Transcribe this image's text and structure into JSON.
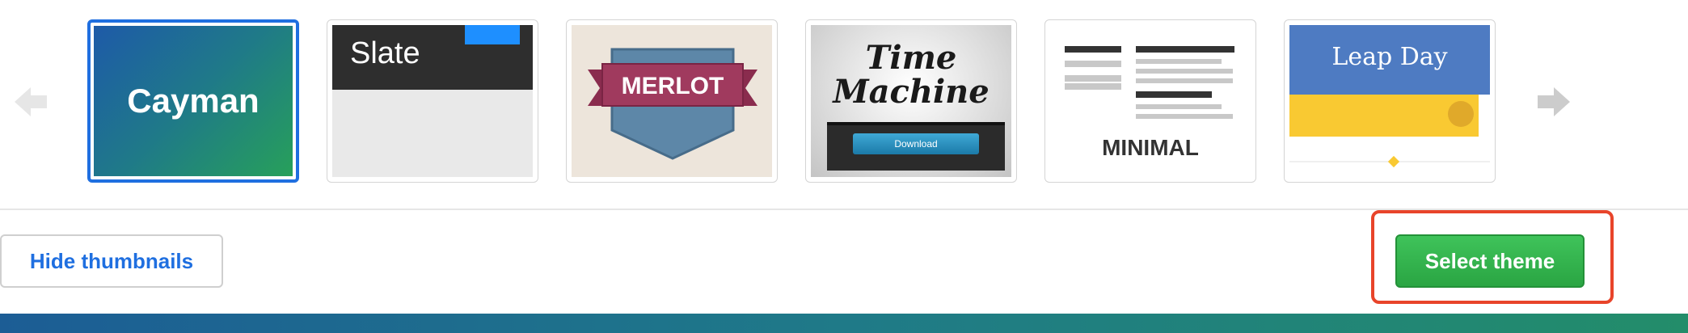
{
  "carousel": {
    "prev_icon": "arrow-left-icon",
    "next_icon": "arrow-right-icon",
    "themes": [
      {
        "label": "Cayman",
        "selected": true
      },
      {
        "label": "Slate",
        "selected": false
      },
      {
        "label": "MERLOT",
        "selected": false
      },
      {
        "label": "Time Machine",
        "button_label": "Download",
        "selected": false
      },
      {
        "label": "MINIMAL",
        "selected": false
      },
      {
        "label": "Leap Day",
        "selected": false
      }
    ]
  },
  "actions": {
    "hide_label": "Hide thumbnails",
    "select_label": "Select theme"
  },
  "colors": {
    "accent_blue": "#1f6fe0",
    "select_green": "#2aa543",
    "highlight_red": "#e8442a"
  }
}
